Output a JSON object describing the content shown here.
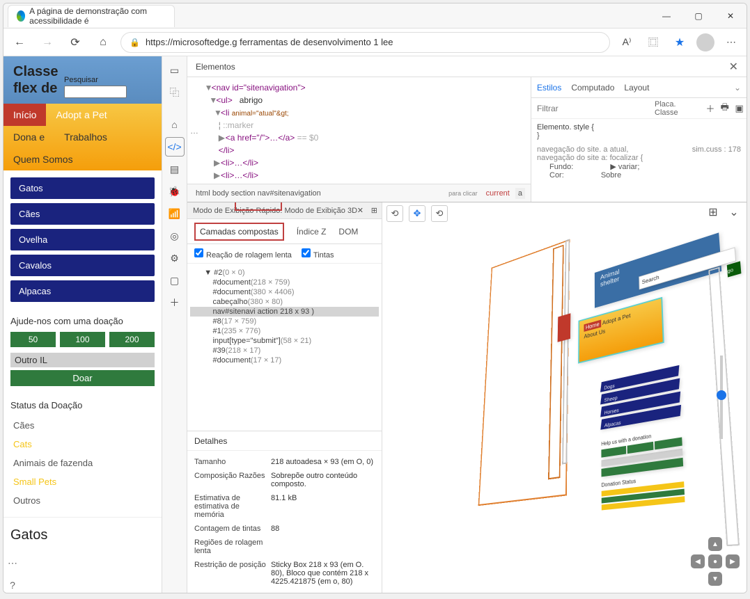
{
  "window": {
    "tab_title": "A página de demonstração com acessibilidade é",
    "url": "https://microsoftedge.g ferramentas de desenvolvimento 1 lee"
  },
  "page": {
    "hero_line1": "Classe",
    "hero_line2": "flex de",
    "search_label": "Pesquisar",
    "nav": {
      "home": "Início",
      "adopt": "Adopt a Pet",
      "owner": "Dona e",
      "jobs": "Trabalhos",
      "about": "Quem Somos"
    },
    "categories": [
      "Gatos",
      "Cães",
      "Ovelha",
      "Cavalos",
      "Alpacas"
    ],
    "donate": {
      "heading": "Ajude-nos com uma doação",
      "amounts": [
        "50",
        "100",
        "200"
      ],
      "other": "Outro IL",
      "give": "Doar"
    },
    "status": {
      "heading": "Status da Doação",
      "rows": [
        "Cães",
        "Cats",
        "Animais de fazenda",
        "Small Pets",
        "Outros"
      ]
    },
    "cats_heading": "Gatos"
  },
  "devtools": {
    "elements_tab": "Elementos",
    "dom": {
      "nav_open": "<nav id=\"sitenavigation\">",
      "ul_open": "<ul>",
      "abrigo": "abrigo",
      "li_open": "<li",
      "li_attr": "animal=\"atual\"&gt;",
      "marker": "::marker",
      "a_open": "<a href=\"/\">…</a>",
      "suffix": "== $0",
      "li_close": "</li>",
      "li_collapsed": "<li>…</li>",
      "dots": "…"
    },
    "breadcrumb": {
      "path": "html body section nav#sitenavigation",
      "para": "para clicar",
      "current": "current",
      "a": "a"
    },
    "styles": {
      "tabs": [
        "Estilos",
        "Computado",
        "Layout"
      ],
      "filter_placeholder": "Filtrar",
      "badge": "Placa. Classe",
      "element_style": "Elemento. style {",
      "brace": "}",
      "rule1": "navegação do site. a atual,",
      "rule2": "navegação do site a: focalizar {",
      "origin": "sim.cuss : 178",
      "prop1_k": "Fundo:",
      "prop1_v": "variar;",
      "prop2_k": "Cor:",
      "prop2_v": "Sobre"
    },
    "quickview": "Modo de Exibição Rápido: Modo de Exibição 3D",
    "tabs3d": {
      "composited": "Camadas compostas",
      "zindex": "Índice Z",
      "dom": "DOM"
    },
    "checks": {
      "slow": "Reação de rolagem lenta",
      "paints": "Tintas"
    },
    "layers": [
      {
        "txt": "#2",
        "dim": "(0 × 0)",
        "indent": 1,
        "exp": true
      },
      {
        "txt": "#document",
        "dim": "(218 × 759)",
        "indent": 2
      },
      {
        "txt": "#document",
        "dim": "(380 × 4406)",
        "indent": 2
      },
      {
        "txt": "cabeçalho",
        "dim": "(380 × 80)",
        "indent": 2
      },
      {
        "txt": "nav#sitenavi action 218 x 93      )",
        "dim": "",
        "indent": 2,
        "sel": true
      },
      {
        "txt": "#8",
        "dim": "(17 × 759)",
        "indent": 2
      },
      {
        "txt": "#1",
        "dim": "(235 × 776)",
        "indent": 2
      },
      {
        "txt": "input[type=\"submit\"]",
        "dim": "(58 × 21)",
        "indent": 2
      },
      {
        "txt": "#39",
        "dim": "(218 × 17)",
        "indent": 2
      },
      {
        "txt": "#document",
        "dim": "(17 × 17)",
        "indent": 2
      }
    ],
    "details": {
      "tab": "Detalhes",
      "rows": [
        {
          "k": "Tamanho",
          "v": "218  autoadesa × 93 (em O, 0)"
        },
        {
          "k": "Composição Razões",
          "v": "Sobrepõe outro conteúdo composto."
        },
        {
          "k": "Estimativa de estimativa de memória",
          "v": "81.1 kB"
        },
        {
          "k": "Contagem de tintas",
          "v": "88"
        },
        {
          "k": "Regiões de rolagem lenta",
          "v": ""
        },
        {
          "k": "Restrição de posição",
          "v": "Sticky Box 218 x 93 (em O. 80), Bloco que contém 218 x 4225.421875 (em o, 80)"
        }
      ]
    },
    "scene": {
      "animal": "Animal",
      "shelter": "shelter",
      "search": "Search",
      "go": "go",
      "home": "Home",
      "adopt": "Adopt a Pet",
      "about": "About Us",
      "dogs": "Dogs",
      "sheep": "Sheep",
      "horses": "Horses",
      "alpacas": "Alpacas",
      "donate_hd": "Help us with a donation",
      "donation_status": "Donation Status"
    }
  }
}
